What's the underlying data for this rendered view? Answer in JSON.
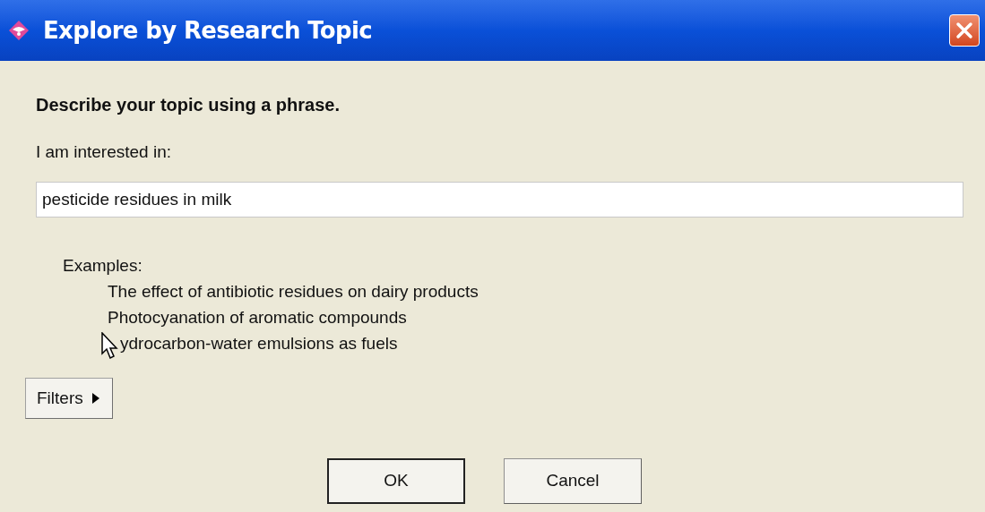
{
  "window": {
    "title": "Explore by Research Topic"
  },
  "heading": "Describe your topic using a phrase.",
  "field_label": "I am interested in:",
  "topic_field": {
    "value": "pesticide residues in milk"
  },
  "examples_label": "Examples:",
  "examples": [
    "The effect of antibiotic residues on dairy products",
    "Photocyanation of aromatic compounds",
    "ydrocarbon-water emulsions as fuels"
  ],
  "filters_button": {
    "label": "Filters",
    "expanded": false
  },
  "buttons": [
    {
      "label": "OK",
      "default": true
    },
    {
      "label": "Cancel",
      "default": false
    }
  ]
}
